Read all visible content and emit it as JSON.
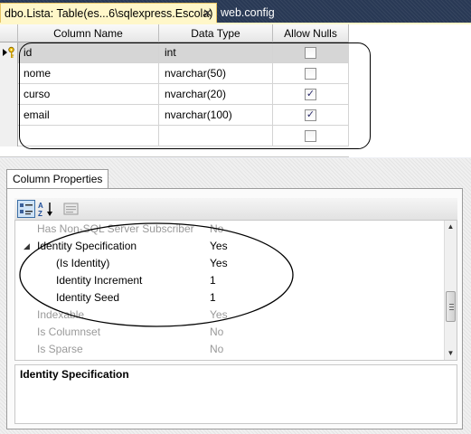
{
  "tabs": {
    "active_label": "dbo.Lista: Table(es...6\\sqlexpress.Escola)",
    "close_glyph": "✕",
    "inactive_label": "web.config"
  },
  "designer": {
    "headers": {
      "column_name": "Column Name",
      "data_type": "Data Type",
      "allow_nulls": "Allow Nulls"
    },
    "rows": [
      {
        "name": "id",
        "type": "int",
        "allow_nulls": false,
        "primary_key": true,
        "selected": true
      },
      {
        "name": "nome",
        "type": "nvarchar(50)",
        "allow_nulls": false
      },
      {
        "name": "curso",
        "type": "nvarchar(20)",
        "allow_nulls": true
      },
      {
        "name": "email",
        "type": "nvarchar(100)",
        "allow_nulls": true
      },
      {
        "name": "",
        "type": "",
        "allow_nulls": false
      }
    ]
  },
  "properties": {
    "tab_label": "Column Properties",
    "toolbar": {
      "categorized_icon": "categorized-icon",
      "alphabetical_icon": "sort-az-icon",
      "pages_icon": "property-pages-icon"
    },
    "rows": [
      {
        "name": "Has Non-SQL Server Subscriber",
        "value": "No",
        "disabled": true,
        "indent": 0
      },
      {
        "name": "Identity Specification",
        "value": "Yes",
        "disabled": false,
        "indent": 0,
        "expander": "◢"
      },
      {
        "name": "(Is Identity)",
        "value": "Yes",
        "disabled": false,
        "indent": 1
      },
      {
        "name": "Identity Increment",
        "value": "1",
        "disabled": false,
        "indent": 1
      },
      {
        "name": "Identity Seed",
        "value": "1",
        "disabled": false,
        "indent": 1
      },
      {
        "name": "Indexable",
        "value": "Yes",
        "disabled": true,
        "indent": 0
      },
      {
        "name": "Is Columnset",
        "value": "No",
        "disabled": true,
        "indent": 0
      },
      {
        "name": "Is Sparse",
        "value": "No",
        "disabled": true,
        "indent": 0
      }
    ],
    "description_title": "Identity Specification"
  },
  "colors": {
    "tabstrip_bg": "#293955",
    "active_tab_bg": "#fff7c9",
    "selection": "#d6d6d6",
    "checkmark": "#2a2a6a",
    "disabled_text": "#9a9a9a"
  },
  "scrollbar": {
    "up": "▲",
    "down": "▼"
  }
}
